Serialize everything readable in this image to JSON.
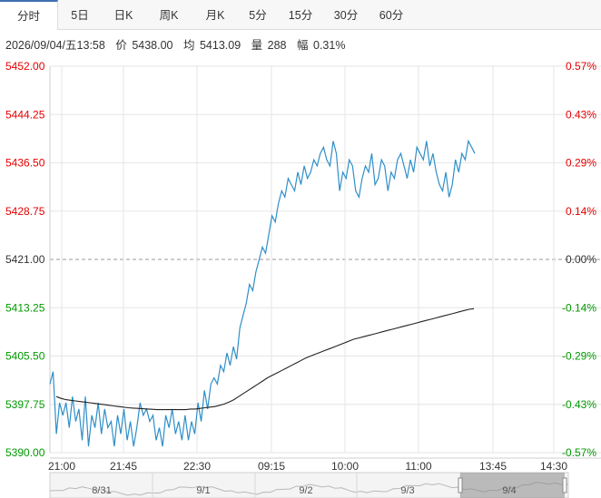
{
  "tabs": [
    {
      "label": "分时",
      "active": true
    },
    {
      "label": "5日"
    },
    {
      "label": "日K"
    },
    {
      "label": "周K"
    },
    {
      "label": "月K"
    },
    {
      "label": "5分"
    },
    {
      "label": "15分"
    },
    {
      "label": "30分"
    },
    {
      "label": "60分"
    }
  ],
  "info": {
    "datetime": "2026/09/04/五13:58",
    "price_label": "价",
    "price": "5438.00",
    "avg_label": "均",
    "avg": "5413.09",
    "vol_label": "量",
    "vol": "288",
    "amp_label": "幅",
    "amp": "0.31%"
  },
  "colors": {
    "up": "#e60000",
    "down": "#009900",
    "flat": "#333333",
    "price_line": "#2f8fc8",
    "avg_line": "#222222",
    "tab_accent": "#3e6fb0"
  },
  "chart_data": {
    "type": "line",
    "prev_close": 5421.0,
    "ylim": [
      5390.0,
      5452.0
    ],
    "left_ticks": [
      "5452.00",
      "5444.25",
      "5436.50",
      "5428.75",
      "5421.00",
      "5413.25",
      "5405.50",
      "5397.75",
      "5390.00"
    ],
    "right_ticks": [
      "0.57%",
      "0.43%",
      "0.29%",
      "0.14%",
      "0.00%",
      "-0.14%",
      "-0.29%",
      "-0.43%",
      "-0.57%"
    ],
    "x_ticks": [
      "21:00",
      "21:45",
      "22:30",
      "09:15",
      "10:00",
      "11:00",
      "13:45",
      "14:30"
    ],
    "series": [
      {
        "values": [
          5401,
          5403,
          5393,
          5398,
          5396,
          5398,
          5394,
          5399,
          5395,
          5397,
          5392,
          5399,
          5391,
          5396,
          5394,
          5398,
          5393,
          5397,
          5394,
          5395,
          5391,
          5396,
          5393,
          5397,
          5392,
          5395,
          5391,
          5394,
          5398,
          5396,
          5397,
          5395,
          5396,
          5392,
          5394,
          5391,
          5396,
          5394,
          5397,
          5393,
          5395,
          5392,
          5396,
          5392,
          5395,
          5393,
          5398,
          5395,
          5400,
          5397,
          5401,
          5402,
          5401,
          5404,
          5403,
          5406,
          5404,
          5407,
          5405,
          5410,
          5412,
          5414,
          5417,
          5416,
          5419,
          5421,
          5423,
          5422,
          5425,
          5428,
          5427,
          5430,
          5432,
          5431,
          5434,
          5433,
          5432,
          5435,
          5433,
          5436,
          5434,
          5435,
          5437,
          5436,
          5438,
          5439,
          5437,
          5436,
          5440,
          5438,
          5432,
          5435,
          5434,
          5437,
          5436,
          5432,
          5431,
          5434,
          5436,
          5435,
          5438,
          5433,
          5434,
          5437,
          5436,
          5432,
          5435,
          5434,
          5437,
          5438,
          5436,
          5434,
          5437,
          5435,
          5439,
          5438,
          5437,
          5440,
          5436,
          5438,
          5435,
          5433,
          5432,
          5435,
          5431,
          5433,
          5437,
          5435,
          5438,
          5437,
          5440,
          5439,
          5438
        ]
      },
      {
        "values": [
          5399,
          5398.7,
          5398.5,
          5398.4,
          5398.3,
          5398.2,
          5398.1,
          5398.0,
          5397.9,
          5397.8,
          5397.7,
          5397.6,
          5397.5,
          5397.4,
          5397.3,
          5397.2,
          5397.15,
          5397.1,
          5397.05,
          5397.0,
          5396.95,
          5396.9,
          5396.9,
          5396.9,
          5396.9,
          5396.9,
          5396.9,
          5396.9,
          5397.0,
          5397.0,
          5397.1,
          5397.2,
          5397.3,
          5397.4,
          5397.6,
          5397.8,
          5398.1,
          5398.5,
          5399.0,
          5399.5,
          5400.0,
          5400.5,
          5401.0,
          5401.5,
          5402.0,
          5402.4,
          5402.8,
          5403.2,
          5403.6,
          5404.0,
          5404.4,
          5404.8,
          5405.2,
          5405.5,
          5405.8,
          5406.1,
          5406.4,
          5406.7,
          5407.0,
          5407.3,
          5407.6,
          5407.9,
          5408.2,
          5408.4,
          5408.6,
          5408.8,
          5409.0,
          5409.2,
          5409.4,
          5409.6,
          5409.8,
          5410.0,
          5410.2,
          5410.4,
          5410.6,
          5410.8,
          5411.0,
          5411.2,
          5411.4,
          5411.6,
          5411.8,
          5412.0,
          5412.2,
          5412.4,
          5412.6,
          5412.8,
          5413.0,
          5413.09
        ]
      }
    ],
    "minimap_labels": [
      "8/31",
      "9/1",
      "9/2",
      "9/3",
      "9/4"
    ]
  }
}
